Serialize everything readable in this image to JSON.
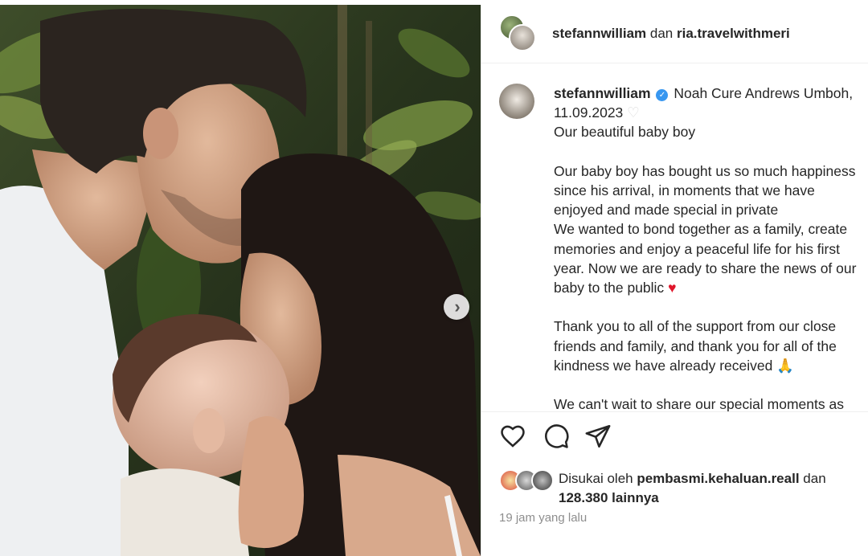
{
  "header": {
    "user1": "stefannwilliam",
    "conjunction": "dan",
    "user2": "ria.travelwithmeri"
  },
  "caption": {
    "username": "stefannwilliam",
    "title_text": "Noah Cure Andrews Umboh,",
    "date": "11.09.2023",
    "line1": "Our beautiful baby boy",
    "para1": "Our baby boy has bought us so much happiness\nsince his arrival, in moments that we have\nenjoyed and made special in private\nWe wanted to bond together as a family, create\nmemories and enjoy a peaceful life for his first\nyear. Now we are ready to share the news of our\nbaby to the public",
    "para2": "Thank you to all of the support from our close\nfriends and family, and thank you for all of the\nkindness we have already received",
    "para3": "We can't wait to share our special moments as"
  },
  "likes": {
    "prefix": "Disukai oleh",
    "user": "pembasmi.kehaluan.reall",
    "conjunction": "dan",
    "count": "128.380 lainnya"
  },
  "timestamp": "19 jam yang lalu",
  "icons": {
    "like": "heart-outline-icon",
    "comment": "comment-bubble-icon",
    "share": "paper-plane-icon",
    "next": "chevron-right-icon",
    "verified": "verified-badge-icon"
  },
  "colors": {
    "verified_blue": "#3897f0",
    "text": "#262626",
    "muted": "#8e8e8e",
    "heart_red": "#e0162b"
  }
}
